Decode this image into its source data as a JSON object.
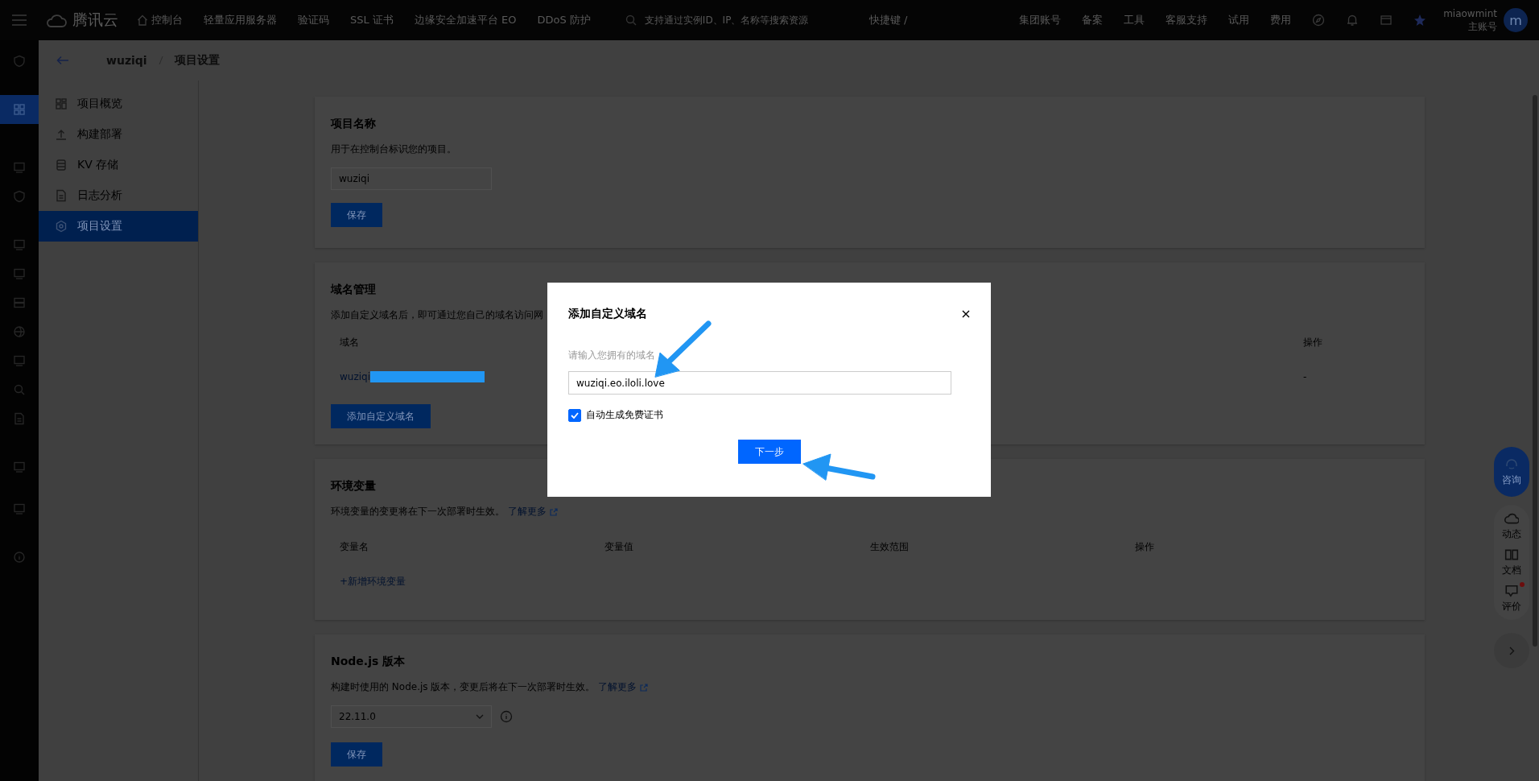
{
  "top_bar": {
    "logo": "腾讯云",
    "nav": [
      {
        "label": "控制台",
        "kind": "home"
      },
      {
        "label": "轻量应用服务器",
        "kind": "text"
      },
      {
        "label": "验证码",
        "kind": "text"
      },
      {
        "label": "SSL 证书",
        "kind": "text"
      },
      {
        "label": "边缘安全加速平台 EO",
        "kind": "text"
      },
      {
        "label": "DDoS 防护",
        "kind": "text"
      }
    ],
    "search": {
      "placeholder": "支持通过实例ID、IP、名称等搜索资源"
    },
    "shortcut": "快捷键 /",
    "links": [
      "集团账号",
      "备案",
      "工具",
      "客服支持",
      "试用",
      "费用"
    ],
    "user": {
      "name": "miaowmint",
      "role": "主账号",
      "avatar": "m"
    }
  },
  "rail": [
    {
      "kind": "shield",
      "selected": false
    },
    {
      "kind": "grid",
      "selected": true
    },
    {
      "kind": "monitor",
      "selected": false
    },
    {
      "kind": "shield",
      "selected": false
    },
    {
      "kind": "monitor",
      "selected": false
    },
    {
      "kind": "monitor",
      "selected": false
    },
    {
      "kind": "server",
      "selected": false
    },
    {
      "kind": "globe",
      "selected": false
    },
    {
      "kind": "monitor",
      "selected": false
    },
    {
      "kind": "search",
      "selected": false
    },
    {
      "kind": "doc",
      "selected": false
    },
    {
      "kind": "monitor",
      "selected": false
    },
    {
      "kind": "monitor",
      "selected": false
    },
    {
      "kind": "info",
      "selected": false
    }
  ],
  "breadcrumb": {
    "project": "wuziqi",
    "page": "项目设置"
  },
  "nav": [
    {
      "label": "项目概览",
      "kind": "overview",
      "selected": false
    },
    {
      "label": "构建部署",
      "kind": "upload",
      "selected": false
    },
    {
      "label": "KV 存储",
      "kind": "database",
      "selected": false
    },
    {
      "label": "日志分析",
      "kind": "doc",
      "selected": false
    },
    {
      "label": "项目设置",
      "kind": "gear",
      "selected": true
    }
  ],
  "project_name": {
    "title": "项目名称",
    "description": "用于在控制台标识您的项目。",
    "value": "wuziqi",
    "button": "保存"
  },
  "domains": {
    "title": "域名管理",
    "description": "添加自定义域名后，即可通过您自己的域名访问网",
    "columns": [
      "域名",
      "操作"
    ],
    "rows": [
      {
        "domain": "wuziqi",
        "redacted": true,
        "action": "-"
      }
    ],
    "button": "添加自定义域名"
  },
  "env": {
    "title": "环境变量",
    "description": "环境变量的变更将在下一次部署时生效。",
    "link": "了解更多",
    "columns": [
      "变量名",
      "变量值",
      "生效范围",
      "操作"
    ],
    "add": "+新增环境变量"
  },
  "node": {
    "title": "Node.js 版本",
    "description": "构建时使用的 Node.js 版本，变更后将在下一次部署时生效。",
    "link": "了解更多",
    "value": "22.11.0",
    "button": "保存"
  },
  "help": {
    "consult": "咨询",
    "items": [
      {
        "label": "动态",
        "kind": "cloud",
        "badge": false
      },
      {
        "label": "文档",
        "kind": "book",
        "badge": false
      },
      {
        "label": "评价",
        "kind": "comment",
        "badge": true
      }
    ]
  },
  "modal": {
    "title": "添加自定义域名",
    "label": "请输入您拥有的域名",
    "value": "wuziqi.eo.iloli.love",
    "checkbox": {
      "label": "自动生成免费证书",
      "checked": true
    },
    "button": "下一步"
  }
}
